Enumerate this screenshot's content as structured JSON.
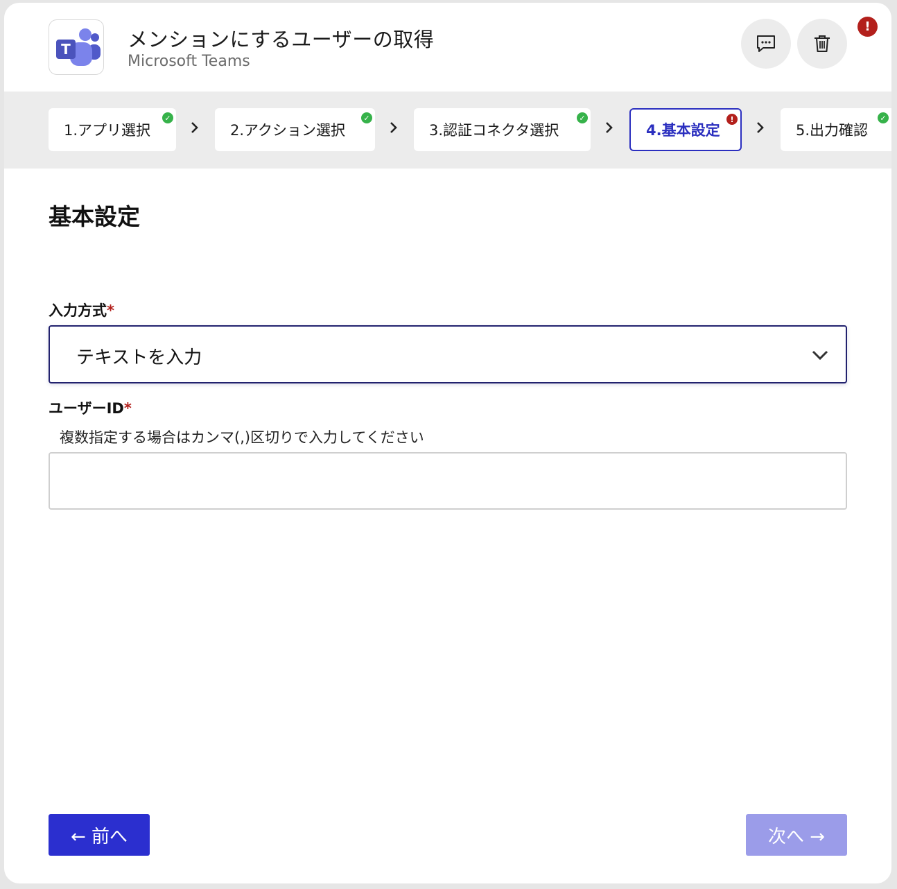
{
  "header": {
    "title": "メンションにするユーザーの取得",
    "subtitle": "Microsoft Teams",
    "app_icon": "microsoft-teams-logo",
    "error_badge": "!"
  },
  "steps": [
    {
      "label": "1.アプリ選択",
      "status": "complete"
    },
    {
      "label": "2.アクション選択",
      "status": "complete"
    },
    {
      "label": "3.認証コネクタ選択",
      "status": "complete"
    },
    {
      "label": "4.基本設定",
      "status": "error",
      "active": true
    },
    {
      "label": "5.出力確認",
      "status": "complete"
    }
  ],
  "main": {
    "section_title": "基本設定",
    "input_method": {
      "label": "入力方式",
      "required_mark": "*",
      "selected": "テキストを入力"
    },
    "user_id": {
      "label": "ユーザーID",
      "required_mark": "*",
      "hint": "複数指定する場合はカンマ(,)区切りで入力してください",
      "value": ""
    }
  },
  "footer": {
    "prev_label": "← 前へ",
    "next_label": "次へ →"
  },
  "colors": {
    "accent": "#2b2fcf",
    "accent_disabled": "#9b9ce9",
    "error": "#b3201c",
    "success": "#36b24a"
  }
}
